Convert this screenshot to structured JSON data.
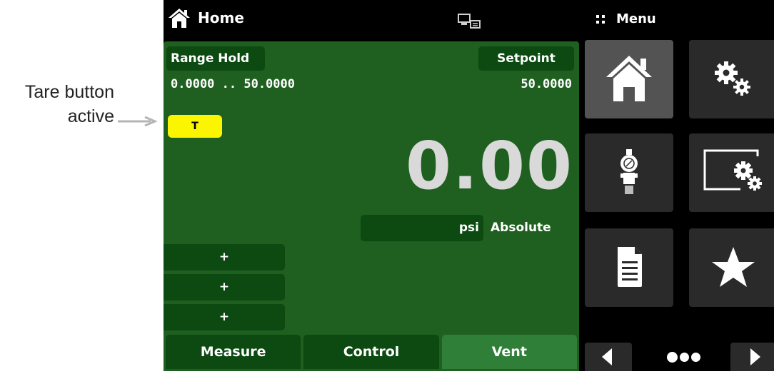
{
  "annotation": {
    "line1": "Tare button",
    "line2": "active"
  },
  "header": {
    "title": "Home",
    "home_icon": "home-icon",
    "status_icon": "remote-connection-icon",
    "menu_label": "Menu",
    "menu_icon": "grip-icon"
  },
  "channel": {
    "range_hold_label": "Range Hold",
    "setpoint_label": "Setpoint",
    "range_text": "0.0000 .. 50.0000",
    "setpoint_value": "50.0000",
    "tare_label": "T",
    "reading": "0.00",
    "unit": "psi",
    "mode": "Absolute",
    "add_buttons": [
      "+",
      "+",
      "+"
    ],
    "tabs": [
      {
        "label": "Measure",
        "active": false
      },
      {
        "label": "Control",
        "active": false
      },
      {
        "label": "Vent",
        "active": true
      }
    ]
  },
  "menu": {
    "tiles": [
      {
        "icon": "home-icon",
        "selected": true
      },
      {
        "icon": "settings-gears-icon",
        "selected": false
      },
      {
        "icon": "pressure-transducer-icon",
        "selected": false
      },
      {
        "icon": "display-settings-icon",
        "selected": false
      },
      {
        "icon": "document-icon",
        "selected": false
      },
      {
        "icon": "star-icon",
        "selected": false
      }
    ],
    "pagination": {
      "prev_icon": "arrow-left-icon",
      "next_icon": "arrow-right-icon",
      "page_indicator": "page-dots-icon"
    }
  },
  "colors": {
    "panel_green": "#1f6020",
    "button_dark_green": "#0c4a12",
    "active_tab_green": "#2f7f38",
    "tare_yellow": "#fbf500",
    "reading_gray": "#d9d9d9",
    "tile_bg": "#2a2a2a",
    "tile_selected_bg": "#535353"
  }
}
